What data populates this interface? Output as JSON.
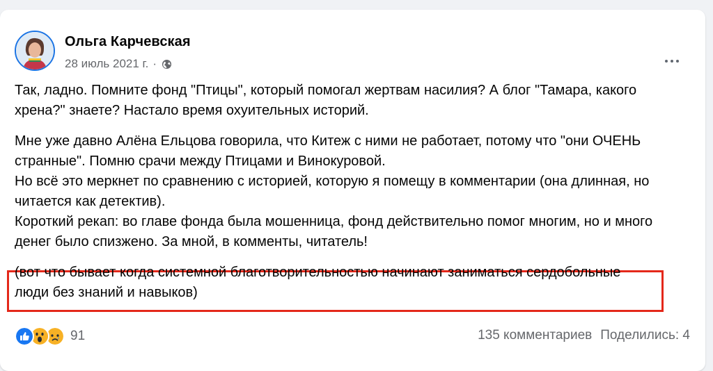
{
  "post": {
    "author": "Ольга Карчевская",
    "date": "28 июль 2021 г.",
    "separator": "·",
    "paragraphs": [
      "Так, ладно. Помните фонд \"Птицы\", который помогал жертвам насилия? А блог \"Тамара, какого хрена?\" знаете? Настало время охуительных историй.",
      "Мне уже давно Алёна Ельцова говорила, что Китеж с ними не работает, потому что \"они ОЧЕНЬ странные\". Помню срачи между Птицами и Винокуровой.\nНо всё это меркнет по сравнению с историей, которую я помещу в комментарии (она длинная, но читается как детектив).\nКороткий рекап: во главе фонда была мошенница, фонд действительно помог многим, но и много денег было спизжено. За мной, в комменты, читатель!",
      "(вот что бывает когда системной благотворительностью начинают заниматься сердобольные люди без знаний и навыков)"
    ]
  },
  "footer": {
    "reactions_count": "91",
    "reaction_icons": [
      "like-icon",
      "wow-icon",
      "sad-icon"
    ],
    "comments": "135 комментариев",
    "shares": "Поделились: 4"
  },
  "colors": {
    "highlight_border": "#e4281a",
    "like_blue": "#1877f2",
    "emoji_yellow": "#f7b125"
  }
}
